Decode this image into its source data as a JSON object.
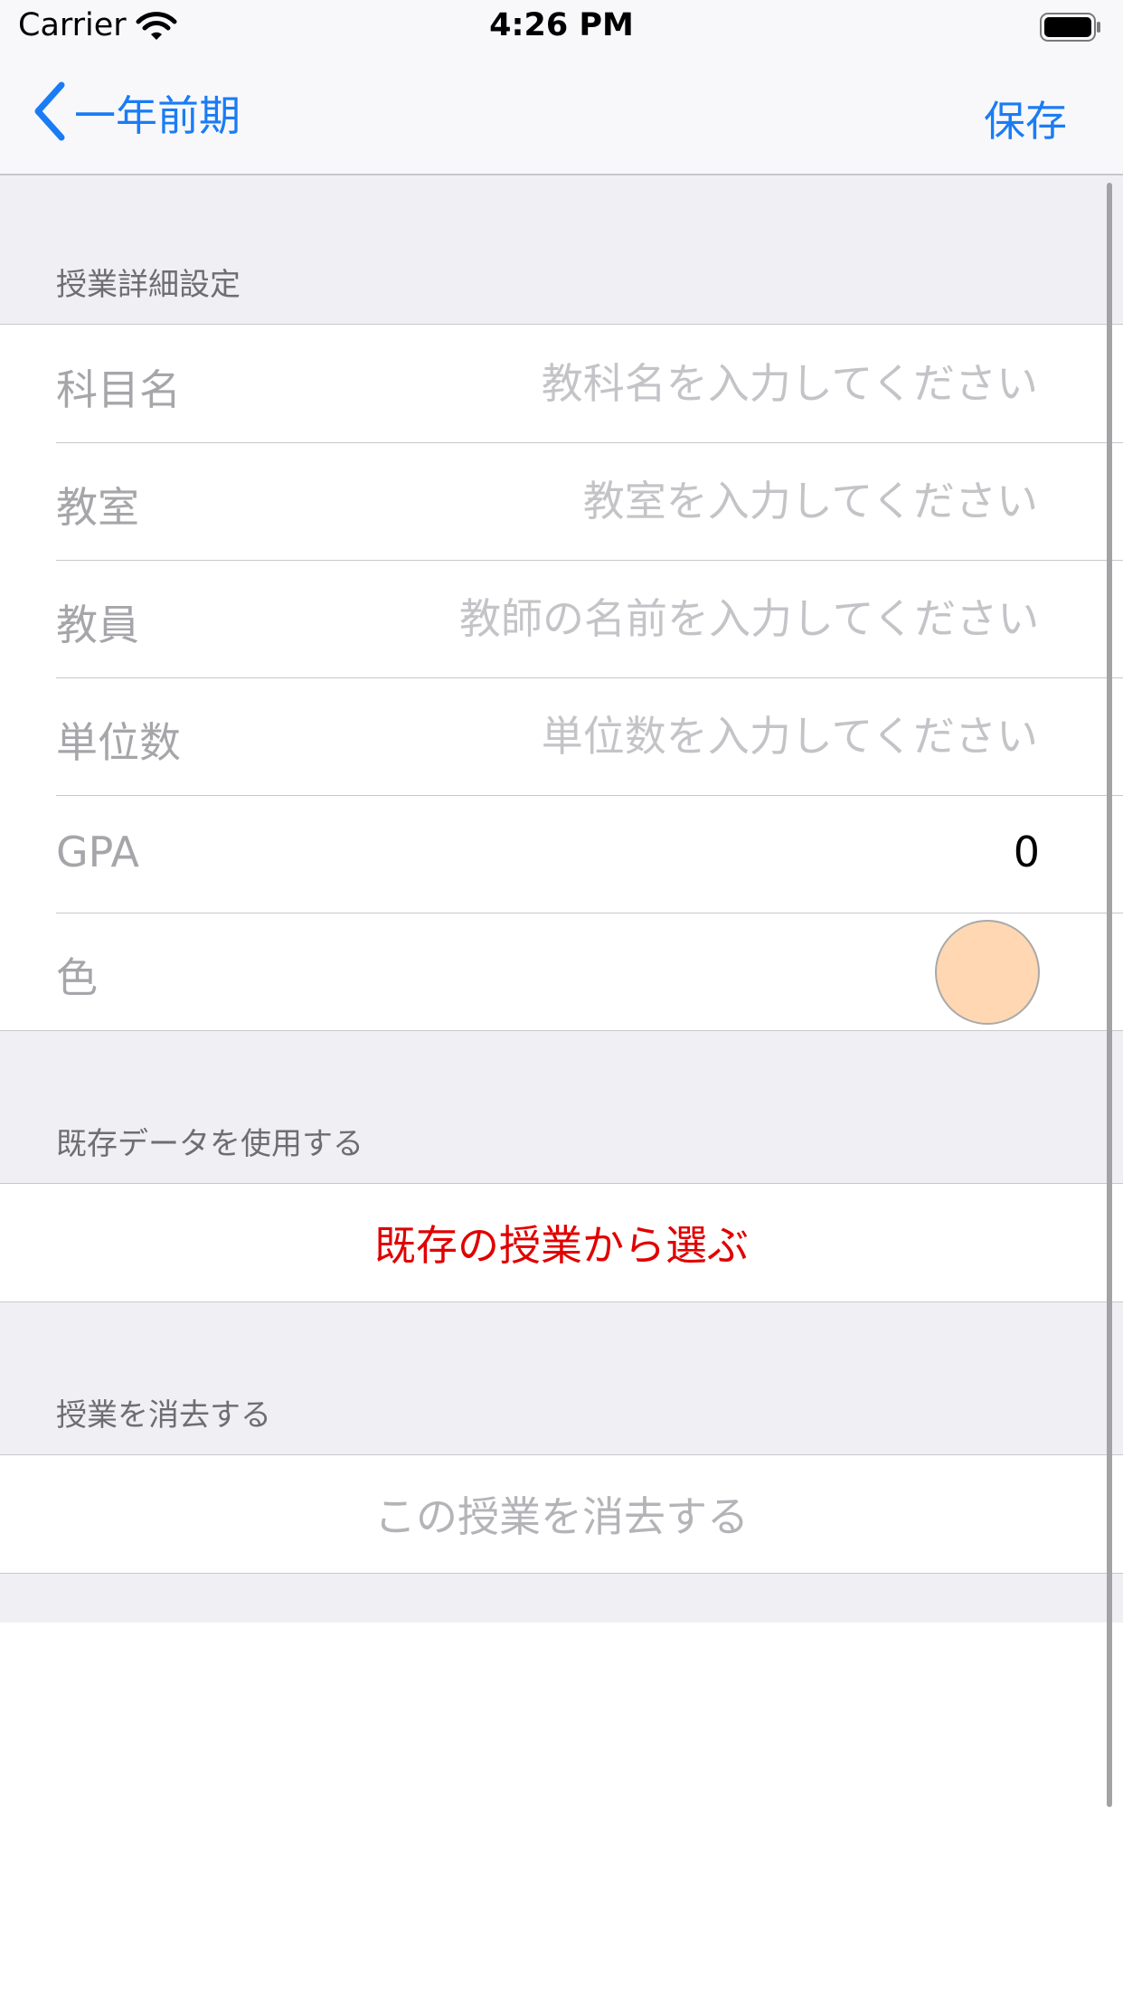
{
  "status_bar": {
    "carrier": "Carrier",
    "time": "4:26 PM"
  },
  "nav": {
    "back_label": "一年前期",
    "save_label": "保存"
  },
  "sections": {
    "detail": {
      "header": "授業詳細設定",
      "rows": [
        {
          "label": "科目名",
          "placeholder": "教科名を入力してください"
        },
        {
          "label": "教室",
          "placeholder": "教室を入力してください"
        },
        {
          "label": "教員",
          "placeholder": "教師の名前を入力してください"
        },
        {
          "label": "単位数",
          "placeholder": "単位数を入力してください"
        },
        {
          "label": "GPA",
          "value": "0"
        },
        {
          "label": "色",
          "color": "#ffd7b2"
        }
      ]
    },
    "existing": {
      "header": "既存データを使用する",
      "action": "既存の授業から選ぶ"
    },
    "delete": {
      "header": "授業を消去する",
      "action": "この授業を消去する"
    }
  },
  "colors": {
    "accent": "#1a7cf5",
    "destructive": "#e00000",
    "group_background": "#efeff4"
  }
}
